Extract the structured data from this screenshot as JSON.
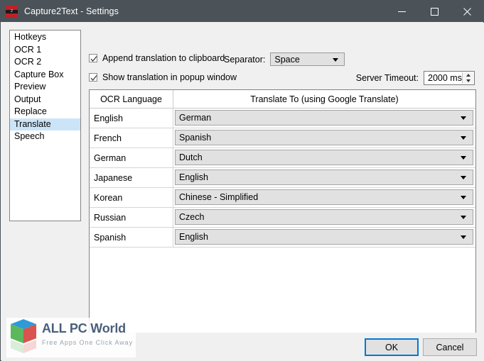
{
  "window": {
    "title": "Capture2Text - Settings",
    "icon_name": "capture2text-app-icon",
    "icon_text": "2",
    "controls": {
      "minimize": "Minimize",
      "maximize": "Maximize",
      "close": "Close"
    },
    "colors": {
      "titlebar": "#4b5358",
      "accent": "#0078d7",
      "selection": "#cce4f7",
      "dialog": "#f0f0f0",
      "combo": "#e1e1e1"
    }
  },
  "sidebar": {
    "items": [
      {
        "label": "Hotkeys",
        "selected": false
      },
      {
        "label": "OCR 1",
        "selected": false
      },
      {
        "label": "OCR 2",
        "selected": false
      },
      {
        "label": "Capture Box",
        "selected": false
      },
      {
        "label": "Preview",
        "selected": false
      },
      {
        "label": "Output",
        "selected": false
      },
      {
        "label": "Replace",
        "selected": false
      },
      {
        "label": "Translate",
        "selected": true
      },
      {
        "label": "Speech",
        "selected": false
      }
    ]
  },
  "options": {
    "append_to_clipboard": {
      "label": "Append translation to clipboard",
      "checked": true
    },
    "show_in_popup": {
      "label": "Show translation in popup window",
      "checked": true
    },
    "separator": {
      "label": "Separator:",
      "value": "Space"
    },
    "server_timeout": {
      "label": "Server Timeout:",
      "value": "2000 ms"
    }
  },
  "table": {
    "headers": {
      "language": "OCR Language",
      "translate_to": "Translate To (using Google Translate)"
    },
    "rows": [
      {
        "language": "English",
        "translate_to": "German"
      },
      {
        "language": "French",
        "translate_to": "Spanish"
      },
      {
        "language": "German",
        "translate_to": "Dutch"
      },
      {
        "language": "Japanese",
        "translate_to": "English"
      },
      {
        "language": "Korean",
        "translate_to": "Chinese - Simplified"
      },
      {
        "language": "Russian",
        "translate_to": "Czech"
      },
      {
        "language": "Spanish",
        "translate_to": "English"
      }
    ]
  },
  "footer": {
    "ok_label": "OK",
    "cancel_label": "Cancel"
  },
  "watermark": {
    "title": "ALL PC World",
    "subtitle": "Free Apps One Click Away"
  }
}
